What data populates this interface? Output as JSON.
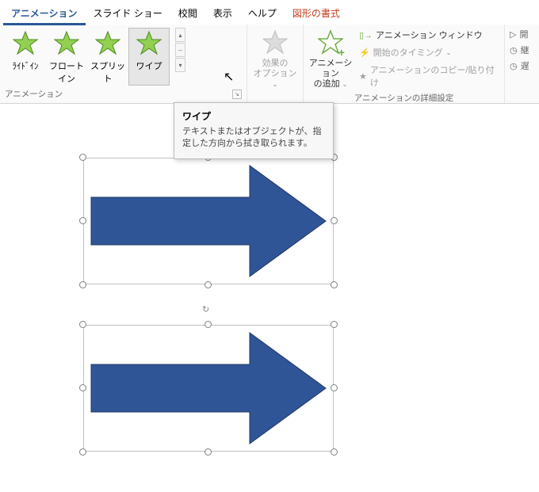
{
  "tabs": {
    "animation": "アニメーション",
    "slideshow": "スライド ショー",
    "review": "校閲",
    "view": "表示",
    "help": "ヘルプ",
    "shapeformat": "図形の書式"
  },
  "gallery": {
    "slidein": "ﾗｲﾄﾞｲﾝ",
    "floatin": "フロートイン",
    "split": "スプリット",
    "wipe": "ワイプ"
  },
  "effectOptions": {
    "label1": "効果の",
    "label2": "オプション"
  },
  "addAnimation": {
    "label1": "アニメーション",
    "label2": "の追加"
  },
  "advanced": {
    "pane": "アニメーション ウィンドウ",
    "trigger": "開始のタイミング",
    "painter": "アニメーションのコピー/貼り付け"
  },
  "right": {
    "start": "開",
    "duration": "継",
    "delay": "遅"
  },
  "groupLabels": {
    "animation": "アニメーション",
    "advanced": "アニメーションの詳細設定"
  },
  "tooltip": {
    "title": "ワイプ",
    "body": "テキストまたはオブジェクトが、指定した方向から拭き取られます。"
  },
  "caret": "⌄",
  "spinUp": "▴",
  "spinRow": "–",
  "spinDown": "▾",
  "launcher": "↘",
  "rightIcon": "▷"
}
